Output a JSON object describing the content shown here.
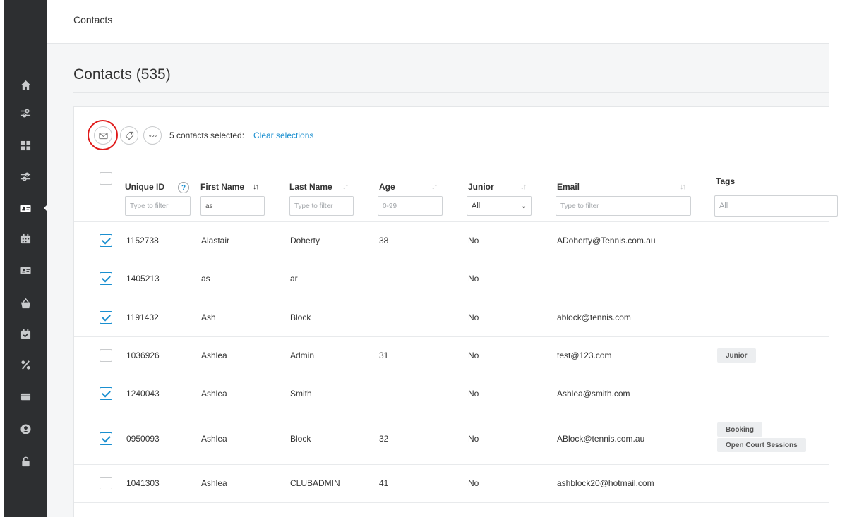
{
  "breadcrumb": "Contacts",
  "page_title": "Contacts (535)",
  "toolbar": {
    "selected_text": "5 contacts selected:",
    "clear_link": "Clear selections"
  },
  "columns": {
    "unique_id": "Unique ID",
    "help": "?",
    "first_name": "First Name",
    "last_name": "Last Name",
    "age": "Age",
    "junior": "Junior",
    "email": "Email",
    "tags": "Tags"
  },
  "sort_glyph": "↓↑",
  "sort_active_glyph": "↓↑",
  "filters": {
    "unique_id_placeholder": "Type to filter",
    "first_name_value": "as",
    "last_name_placeholder": "Type to filter",
    "age_placeholder": "0-99",
    "junior_value": "All",
    "junior_chevron": "⌄",
    "email_placeholder": "Type to filter",
    "tags_placeholder": "All"
  },
  "rows": [
    {
      "id": "1152738",
      "first": "Alastair",
      "last": "Doherty",
      "age": "38",
      "junior": "No",
      "email": "ADoherty@Tennis.com.au",
      "checked": true,
      "tags": []
    },
    {
      "id": "1405213",
      "first": "as",
      "last": "ar",
      "age": "",
      "junior": "No",
      "email": "",
      "checked": true,
      "tags": []
    },
    {
      "id": "1191432",
      "first": "Ash",
      "last": "Block",
      "age": "",
      "junior": "No",
      "email": "ablock@tennis.com",
      "checked": true,
      "tags": []
    },
    {
      "id": "1036926",
      "first": "Ashlea",
      "last": "Admin",
      "age": "31",
      "junior": "No",
      "email": "test@123.com",
      "checked": false,
      "tags": [
        "Junior"
      ]
    },
    {
      "id": "1240043",
      "first": "Ashlea",
      "last": "Smith",
      "age": "",
      "junior": "No",
      "email": "Ashlea@smith.com",
      "checked": true,
      "tags": []
    },
    {
      "id": "0950093",
      "first": "Ashlea",
      "last": "Block",
      "age": "32",
      "junior": "No",
      "email": "ABlock@tennis.com.au",
      "checked": true,
      "tags": [
        "Booking",
        "Open Court Sessions"
      ]
    },
    {
      "id": "1041303",
      "first": "Ashlea",
      "last": "CLUBADMIN",
      "age": "41",
      "junior": "No",
      "email": "ashblock20@hotmail.com",
      "checked": false,
      "tags": []
    }
  ],
  "sidebar": [
    "home-icon",
    "sliders-icon",
    "grid-icon",
    "sliders-icon",
    "contact-card-icon",
    "calendar-icon",
    "id-card-icon",
    "basket-icon",
    "calendar-check-icon",
    "percent-icon",
    "ticket-icon",
    "user-circle-icon",
    "unlock-icon"
  ],
  "colors": {
    "sidebar": "#2d2f31",
    "accent": "#1a8fd0",
    "highlight": "#e01b1b"
  }
}
